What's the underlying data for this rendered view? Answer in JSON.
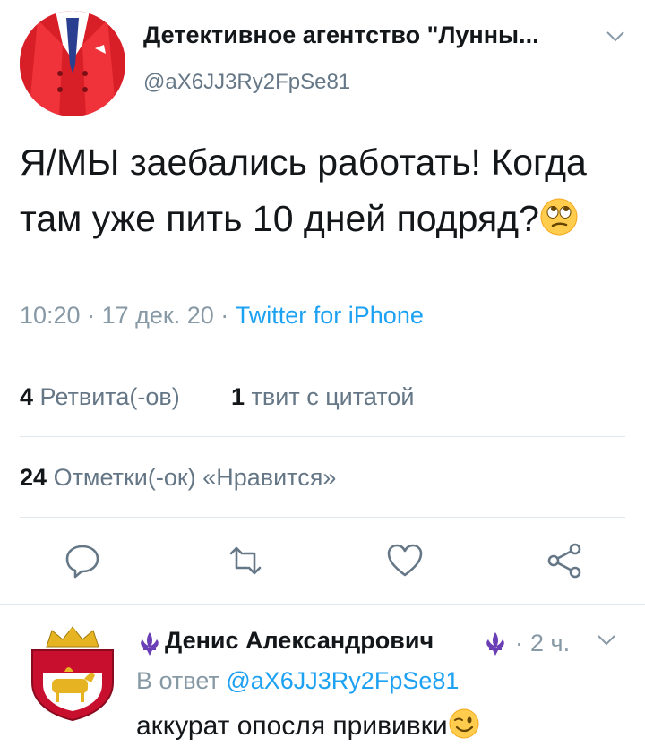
{
  "tweet": {
    "display_name": "Детективное агентство \"Лунны...",
    "handle": "@aX6JJ3Ry2FpSe81",
    "text": "Я/МЫ заебались работать! Когда там уже пить 10 дней подряд?",
    "emoji": "face-with-rolling-eyes",
    "time": "10:20",
    "date": "17 дек. 20",
    "source": "Twitter for iPhone",
    "retweets_count": "4",
    "retweets_label": "Ретвита(-ов)",
    "quotes_count": "1",
    "quotes_label": "твит с цитатой",
    "likes_count": "24",
    "likes_label": "Отметки(-ок) «Нравится»"
  },
  "reply": {
    "display_name": "Денис Александрович",
    "time": "2 ч.",
    "in_reply_prefix": "В ответ",
    "in_reply_handle": "@aX6JJ3Ry2FpSe81",
    "text": "аккурат опосля прививки",
    "emoji": "winking-face"
  },
  "colors": {
    "link": "#1da1f2",
    "muted": "#657786",
    "text": "#14171a",
    "avatar_red": "#e8262d"
  }
}
